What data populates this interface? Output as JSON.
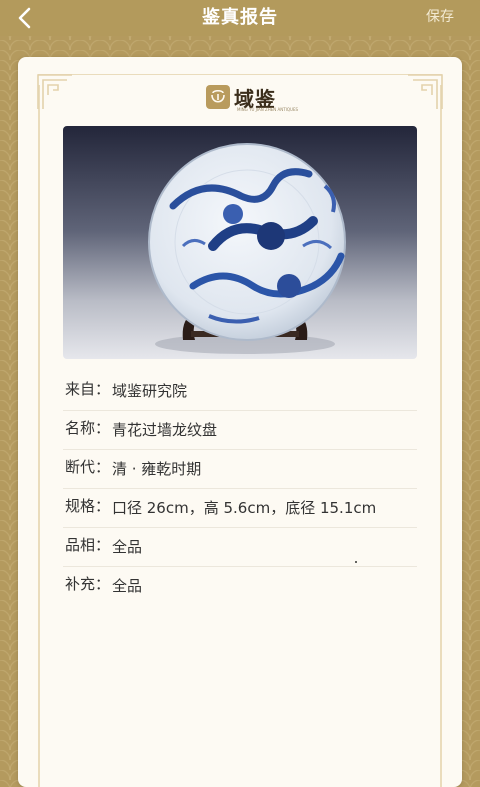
{
  "header": {
    "title": "鉴真报告",
    "save_label": "保存"
  },
  "logo": {
    "text": "域鉴",
    "tagline": "MING YU JIAN ZHEN ANTIQUES"
  },
  "photo": {
    "subject": "blue-and-white-dragon-plate-icon"
  },
  "details": [
    {
      "label": "来自：",
      "value": "域鉴研究院"
    },
    {
      "label": "名称：",
      "value": "青花过墙龙纹盘"
    },
    {
      "label": "断代：",
      "value": "清 · 雍乾时期"
    },
    {
      "label": "规格：",
      "value": "口径 26cm，高 5.6cm，底径 15.1cm"
    },
    {
      "label": "品相：",
      "value": "全品"
    },
    {
      "label": "补充：",
      "value": "全品"
    }
  ],
  "colors": {
    "gold": "#b39a5c",
    "card": "#fdfaf3",
    "text": "#333333"
  }
}
